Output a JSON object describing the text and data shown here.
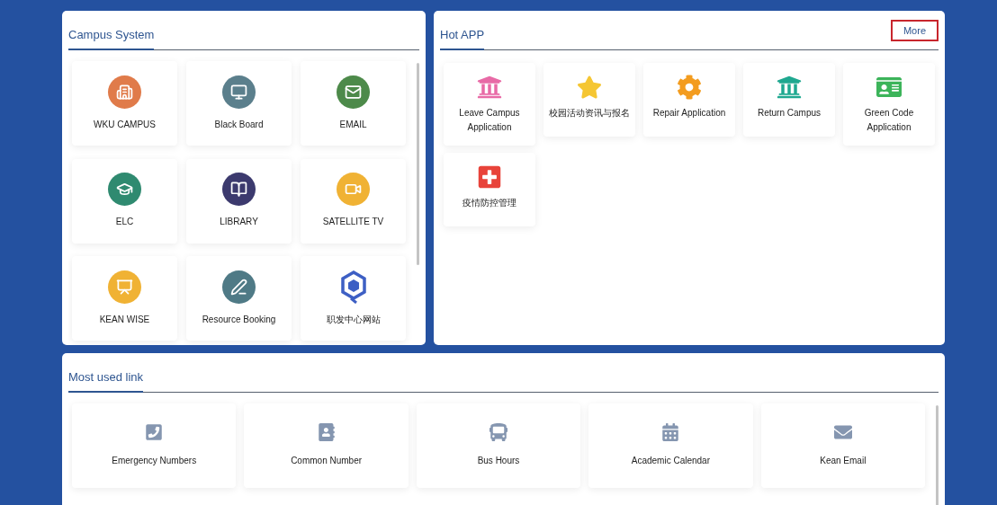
{
  "campus_system": {
    "title": "Campus System",
    "items": [
      {
        "label": "WKU CAMPUS",
        "kind": "circle",
        "color": "#e07b4a"
      },
      {
        "label": "Black Board",
        "kind": "circle",
        "color": "#5b7f8c"
      },
      {
        "label": "EMAIL",
        "kind": "circle",
        "color": "#4d8a4a"
      },
      {
        "label": "ELC",
        "kind": "circle",
        "color": "#2f8a70"
      },
      {
        "label": "LIBRARY",
        "kind": "circle",
        "color": "#3c3a6e"
      },
      {
        "label": "SATELLITE TV",
        "kind": "circle",
        "color": "#f0b234"
      },
      {
        "label": "KEAN WISE",
        "kind": "circle",
        "color": "#f0b234"
      },
      {
        "label": "Resource Booking",
        "kind": "circle",
        "color": "#4f7a86"
      },
      {
        "label": "职发中心网站",
        "kind": "logo",
        "color": "#3d5fc4"
      }
    ]
  },
  "hot_app": {
    "title": "Hot APP",
    "more": "More",
    "items": [
      {
        "label": "Leave Campus Application",
        "color": "#e86aa6"
      },
      {
        "label": "校园活动资讯与报名",
        "color": "#f5c633"
      },
      {
        "label": "Repair Application",
        "color": "#f39c1f"
      },
      {
        "label": "Return Campus",
        "color": "#1fa890"
      },
      {
        "label": "Green Code Application",
        "color": "#3cb45a"
      },
      {
        "label": "疫情防控管理",
        "color": "#e8433a"
      }
    ]
  },
  "most_used_link": {
    "title": "Most used link",
    "items": [
      {
        "label": "Emergency Numbers"
      },
      {
        "label": "Common Number"
      },
      {
        "label": "Bus Hours"
      },
      {
        "label": "Academic Calendar"
      },
      {
        "label": "Kean Email"
      }
    ]
  }
}
